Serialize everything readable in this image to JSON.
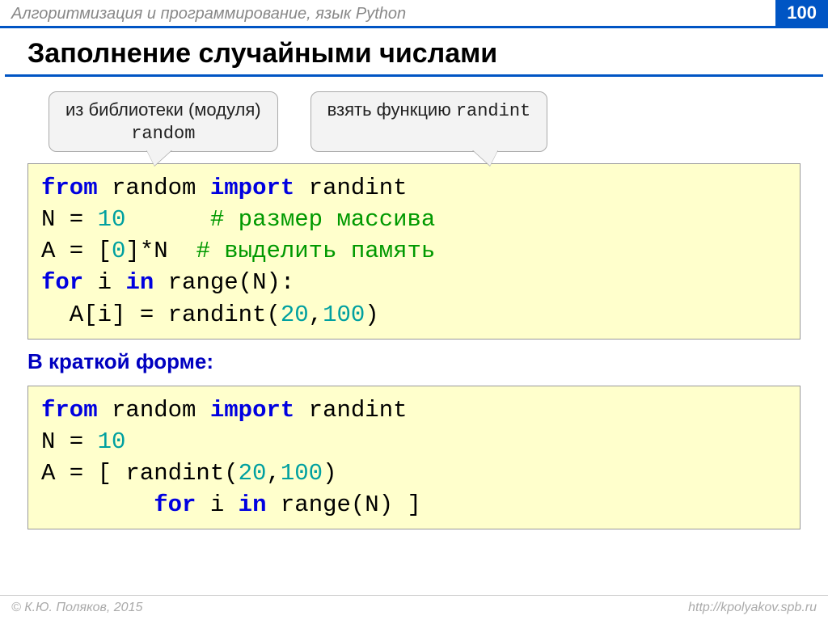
{
  "header": {
    "subject": "Алгоритмизация и программирование, язык Python",
    "page": "100"
  },
  "title": "Заполнение случайными числами",
  "callouts": {
    "left_line1": "из библиотеки (модуля)",
    "left_line2": "random",
    "right_prefix": "взять функцию ",
    "right_mono": "randint"
  },
  "code1": {
    "l1_kw1": "from",
    "l1_t1": " random ",
    "l1_kw2": "import",
    "l1_t2": " randint",
    "l2_t1": "N = ",
    "l2_num": "10",
    "l2_pad": "      ",
    "l2_com": "# размер массива",
    "l3_t1": "A = [",
    "l3_num": "0",
    "l3_t2": "]*N  ",
    "l3_com": "# выделить память",
    "l4_kw1": "for",
    "l4_t1": " i ",
    "l4_kw2": "in",
    "l4_t2": " range(N):",
    "l5_t1": "  A[i] = randint(",
    "l5_n1": "20",
    "l5_t2": ",",
    "l5_n2": "100",
    "l5_t3": ")"
  },
  "subheading": "В краткой форме:",
  "code2": {
    "l1_kw1": "from",
    "l1_t1": " random ",
    "l1_kw2": "import",
    "l1_t2": " randint",
    "l2_t1": "N = ",
    "l2_num": "10",
    "l3_t1": "A = [ randint(",
    "l3_n1": "20",
    "l3_t2": ",",
    "l3_n2": "100",
    "l3_t3": ") ",
    "l4_pad": "        ",
    "l4_kw1": "for",
    "l4_t1": " i ",
    "l4_kw2": "in",
    "l4_t2": " range(N) ]"
  },
  "footer": {
    "left": "© К.Ю. Поляков, 2015",
    "right": "http://kpolyakov.spb.ru"
  }
}
